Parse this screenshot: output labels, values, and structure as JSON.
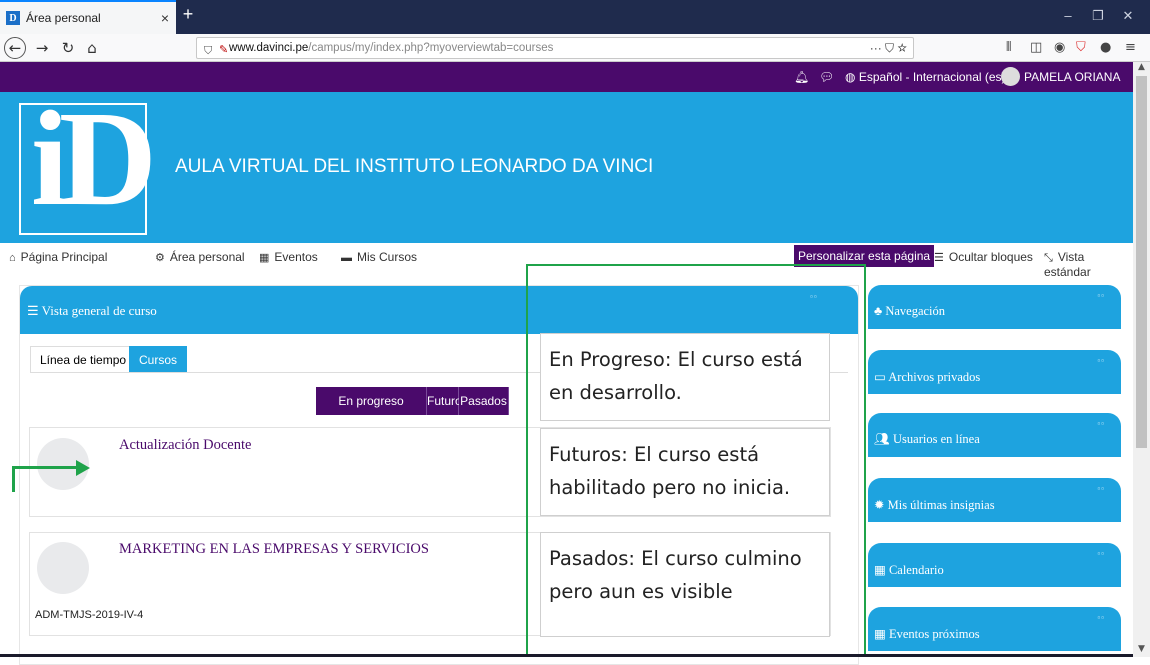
{
  "browser": {
    "tab_title": "Área personal",
    "tab_favicon": "D",
    "tab_close": "×",
    "new_tab": "+",
    "url_domain": "www.davinci.pe",
    "url_path": "/campus/my/index.php?myoverviewtab=courses",
    "url_actions": "··· ⛉ ☆",
    "window_controls": [
      "–",
      "❐",
      "✕"
    ]
  },
  "header": {
    "notification_icon": "bell-icon",
    "messages_icon": "chat-icon",
    "language": "Español - Internacional (es)",
    "user_name": "PAMELA ORIANA",
    "user_caret": "⌄"
  },
  "banner": {
    "logo_text": "iD",
    "site_title": "AULA VIRTUAL DEL INSTITUTO LEONARDO DA VINCI"
  },
  "menu": {
    "items": [
      {
        "label": "Página Principal",
        "icon": "home-icon"
      },
      {
        "label": "Área personal",
        "icon": "dashboard-icon"
      },
      {
        "label": "Eventos",
        "icon": "calendar-icon"
      },
      {
        "label": "Mis Cursos",
        "icon": "briefcase-icon"
      }
    ],
    "customize": "Personalizar esta página",
    "hide_blocks": "Ocultar bloques",
    "standard_view": "Vista estándar"
  },
  "overview": {
    "title": "Vista general de curso",
    "tabs": [
      "Línea de tiempo",
      "Cursos"
    ],
    "filters": [
      "En progreso",
      "Futuros",
      "Pasados"
    ],
    "courses": [
      {
        "name": "Actualización Docente",
        "code": ""
      },
      {
        "name": "MARKETING EN LAS EMPRESAS Y SERVICIOS",
        "code": "ADM-TMJS-2019-IV-4"
      }
    ]
  },
  "sidebar_blocks": [
    {
      "label": "Navegación",
      "icon": "sitemap-icon"
    },
    {
      "label": "Archivos privados",
      "icon": "folder-icon"
    },
    {
      "label": "Usuarios en línea",
      "icon": "users-icon"
    },
    {
      "label": "Mis últimas insignias",
      "icon": "badge-icon"
    },
    {
      "label": "Calendario",
      "icon": "calendar-icon"
    },
    {
      "label": "Eventos próximos",
      "icon": "calendar-icon"
    }
  ],
  "annotations": [
    "En Progreso: El curso está en desarrollo.",
    "Futuros: El curso está habilitado pero no inicia.",
    "Pasados: El curso culmino pero aun es visible"
  ],
  "colors": {
    "primary_purple": "#4a0a6b",
    "primary_blue": "#1ea3df",
    "annotation_green": "#1fa34a"
  }
}
